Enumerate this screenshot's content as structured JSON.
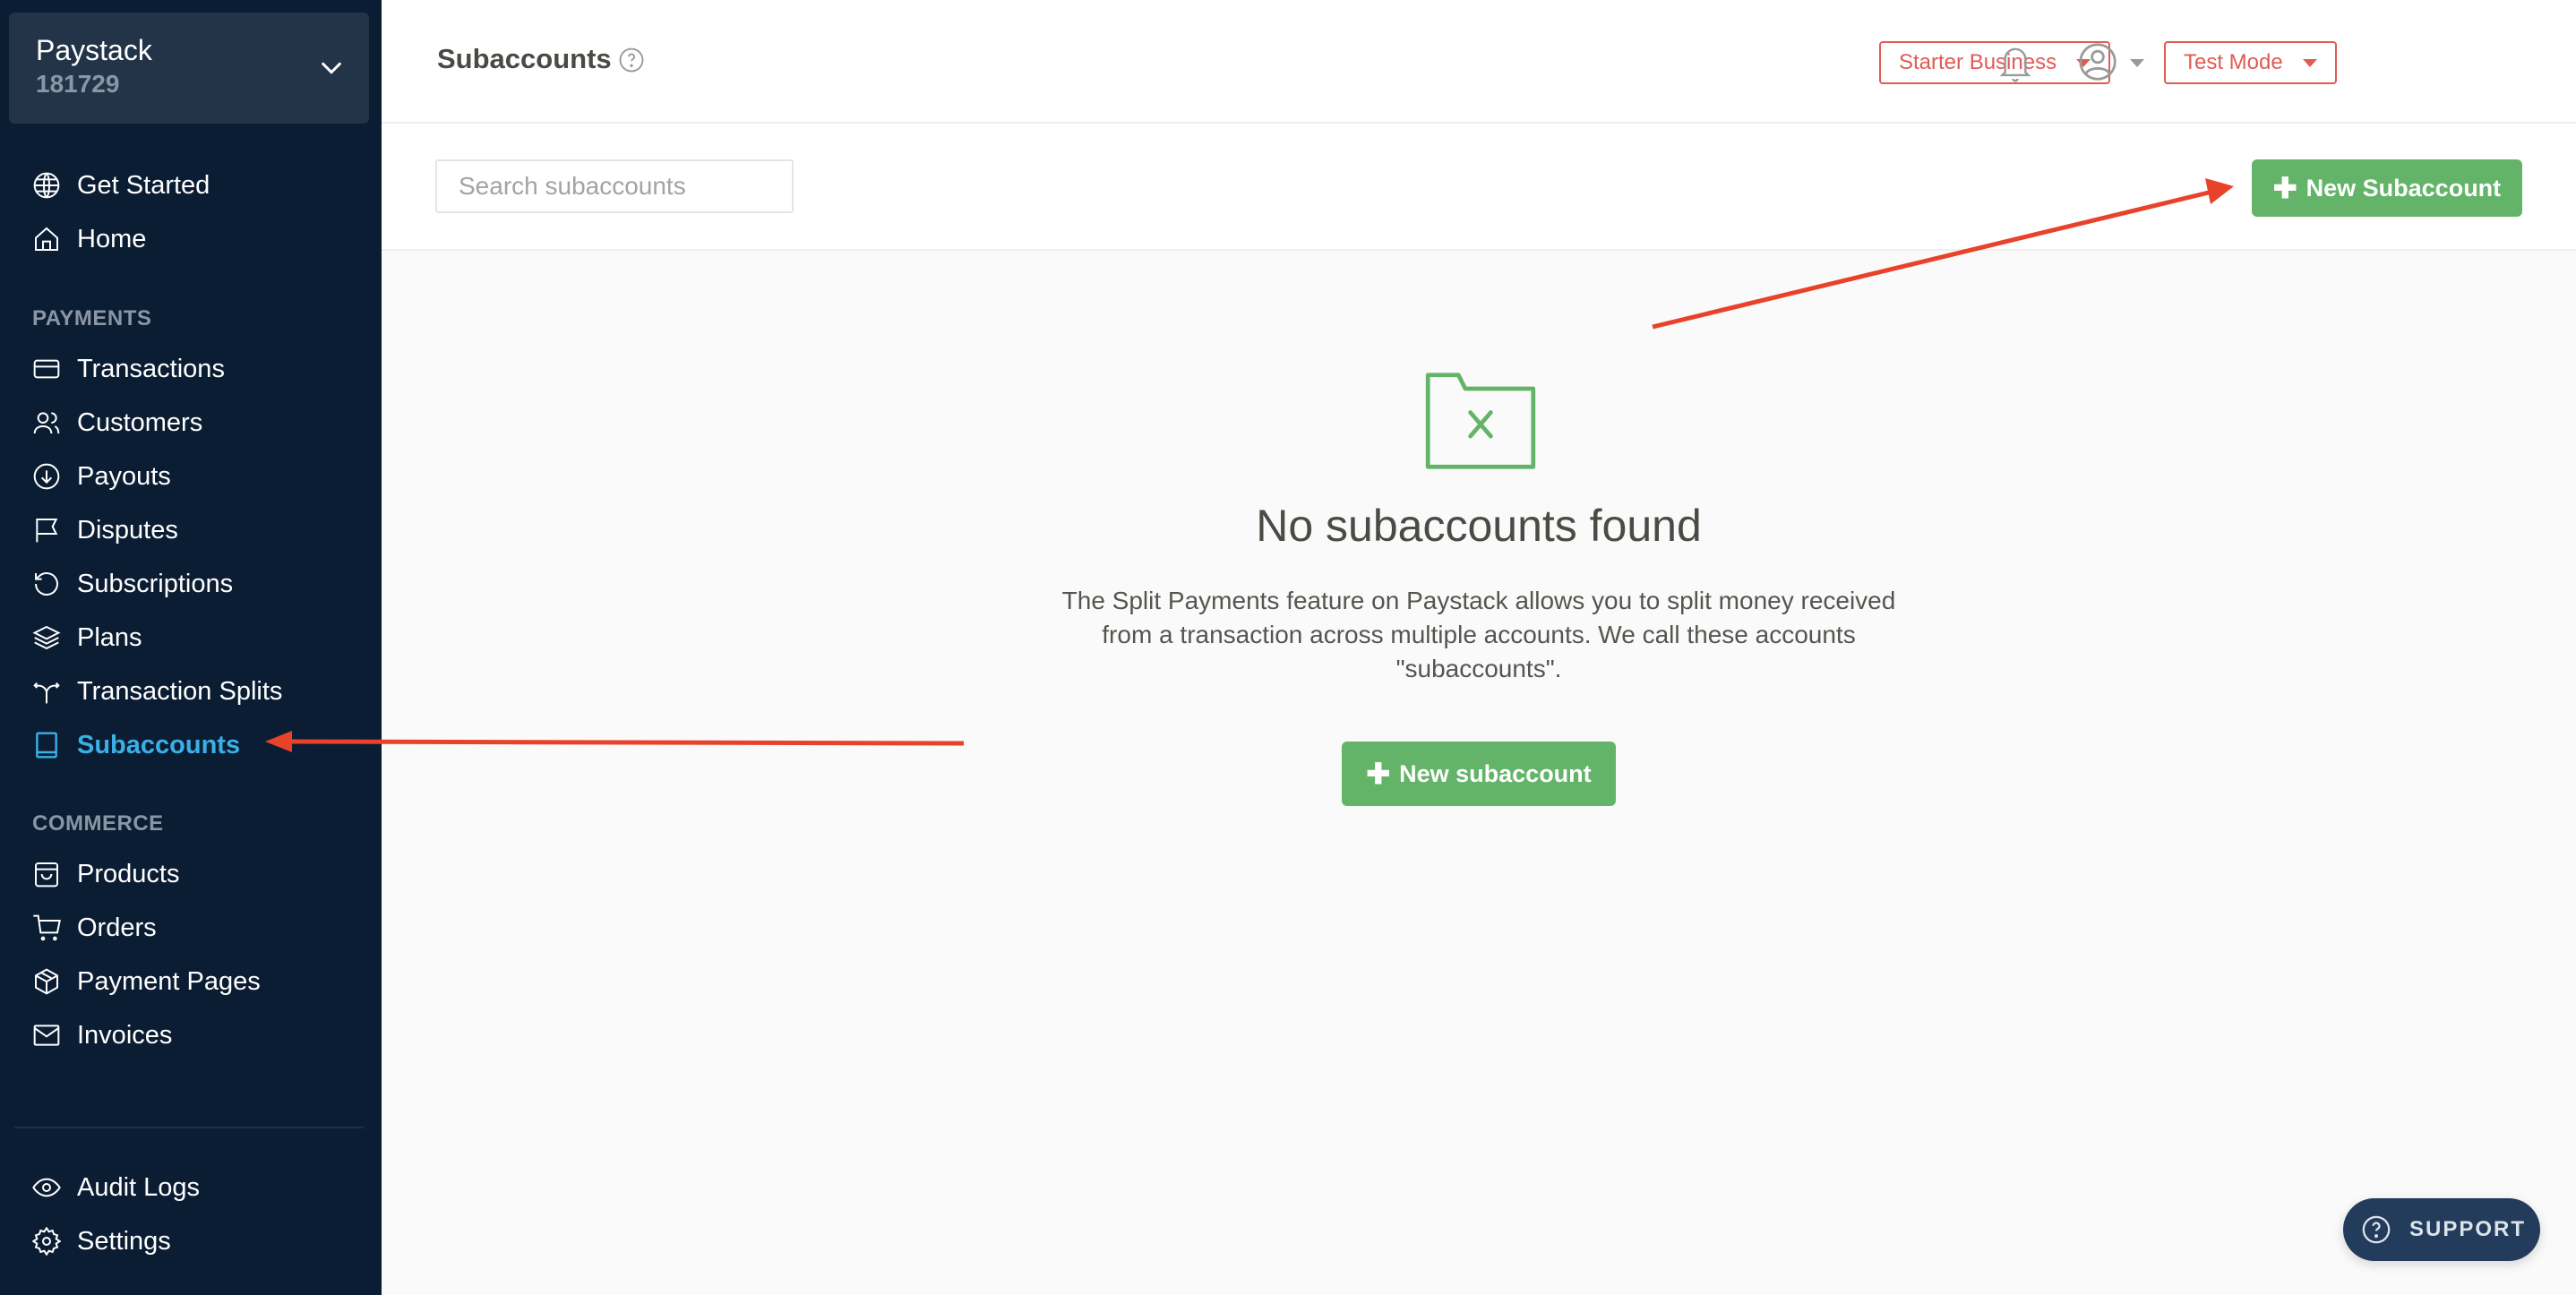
{
  "business": {
    "name": "Paystack",
    "id": "181729"
  },
  "sidebar": {
    "top_items": [
      {
        "label": "Get Started",
        "icon": "globe-icon"
      },
      {
        "label": "Home",
        "icon": "home-icon"
      }
    ],
    "payments_label": "PAYMENTS",
    "payments_items": [
      {
        "label": "Transactions",
        "icon": "credit-card-icon"
      },
      {
        "label": "Customers",
        "icon": "users-icon"
      },
      {
        "label": "Payouts",
        "icon": "arrow-down-circle-icon"
      },
      {
        "label": "Disputes",
        "icon": "flag-icon"
      },
      {
        "label": "Subscriptions",
        "icon": "refresh-icon"
      },
      {
        "label": "Plans",
        "icon": "layers-icon"
      },
      {
        "label": "Transaction Splits",
        "icon": "split-icon"
      },
      {
        "label": "Subaccounts",
        "icon": "book-icon",
        "active": true
      }
    ],
    "commerce_label": "COMMERCE",
    "commerce_items": [
      {
        "label": "Products",
        "icon": "shopping-bag-icon"
      },
      {
        "label": "Orders",
        "icon": "cart-icon"
      },
      {
        "label": "Payment Pages",
        "icon": "box-icon"
      },
      {
        "label": "Invoices",
        "icon": "mail-icon"
      }
    ],
    "bottom_items": [
      {
        "label": "Audit Logs",
        "icon": "eye-icon"
      },
      {
        "label": "Settings",
        "icon": "gear-icon"
      }
    ]
  },
  "header": {
    "title": "Subaccounts",
    "plan_dropdown": "Starter Business",
    "mode_dropdown": "Test Mode"
  },
  "toolbar": {
    "search_placeholder": "Search subaccounts",
    "new_button": "New Subaccount"
  },
  "empty_state": {
    "title": "No subaccounts found",
    "description": "The Split Payments feature on Paystack allows you to split money received from a transaction across multiple accounts. We call these accounts \"subaccounts\".",
    "button": "New subaccount"
  },
  "support": {
    "label": "SUPPORT"
  },
  "colors": {
    "sidebar_bg": "#0b1d33",
    "active_nav": "#3bb0e7",
    "primary_green": "#63b469",
    "header_accent": "#e05b54",
    "annotation_arrow": "#e8432a"
  }
}
